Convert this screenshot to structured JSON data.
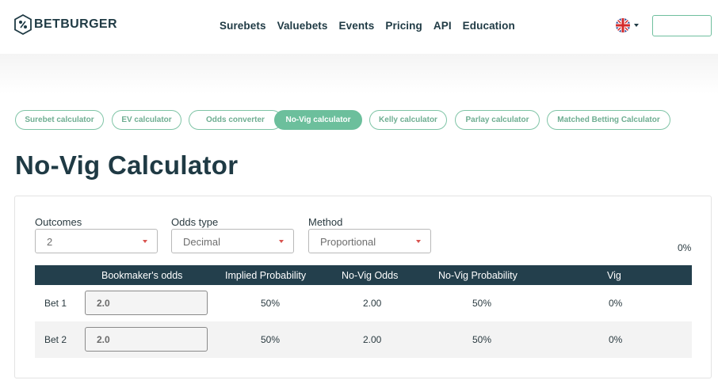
{
  "brand": {
    "name": "BETBURGER"
  },
  "nav": {
    "items": [
      "Surebets",
      "Valuebets",
      "Events",
      "Pricing",
      "API",
      "Education"
    ]
  },
  "header": {
    "flag_icon": "uk-flag-icon"
  },
  "colors": {
    "accent": "#6cbf9c",
    "dark": "#233f4c",
    "caret": "#d9534f"
  },
  "tools": {
    "items": [
      "Surebet calculator",
      "EV calculator",
      "Odds converter",
      "No-Vig calculator",
      "Kelly calculator",
      "Parlay calculator",
      "Matched Betting Calculator"
    ],
    "active": "No-Vig calculator"
  },
  "page": {
    "title": "No-Vig Calculator"
  },
  "calculator": {
    "outcomes": {
      "label": "Outcomes",
      "value": "2"
    },
    "odds_type": {
      "label": "Odds type",
      "value": "Decimal"
    },
    "method": {
      "label": "Method",
      "value": "Proportional"
    },
    "total_vig": "0%",
    "table": {
      "headers": [
        "Bookmaker's odds",
        "Implied Probability",
        "No-Vig Odds",
        "No-Vig Probability",
        "Vig"
      ],
      "rows": [
        {
          "label": "Bet 1",
          "odds": "2.0",
          "implied": "50%",
          "novig_odds": "2.00",
          "novig_prob": "50%",
          "vig": "0%"
        },
        {
          "label": "Bet 2",
          "odds": "2.0",
          "implied": "50%",
          "novig_odds": "2.00",
          "novig_prob": "50%",
          "vig": "0%"
        }
      ]
    }
  }
}
